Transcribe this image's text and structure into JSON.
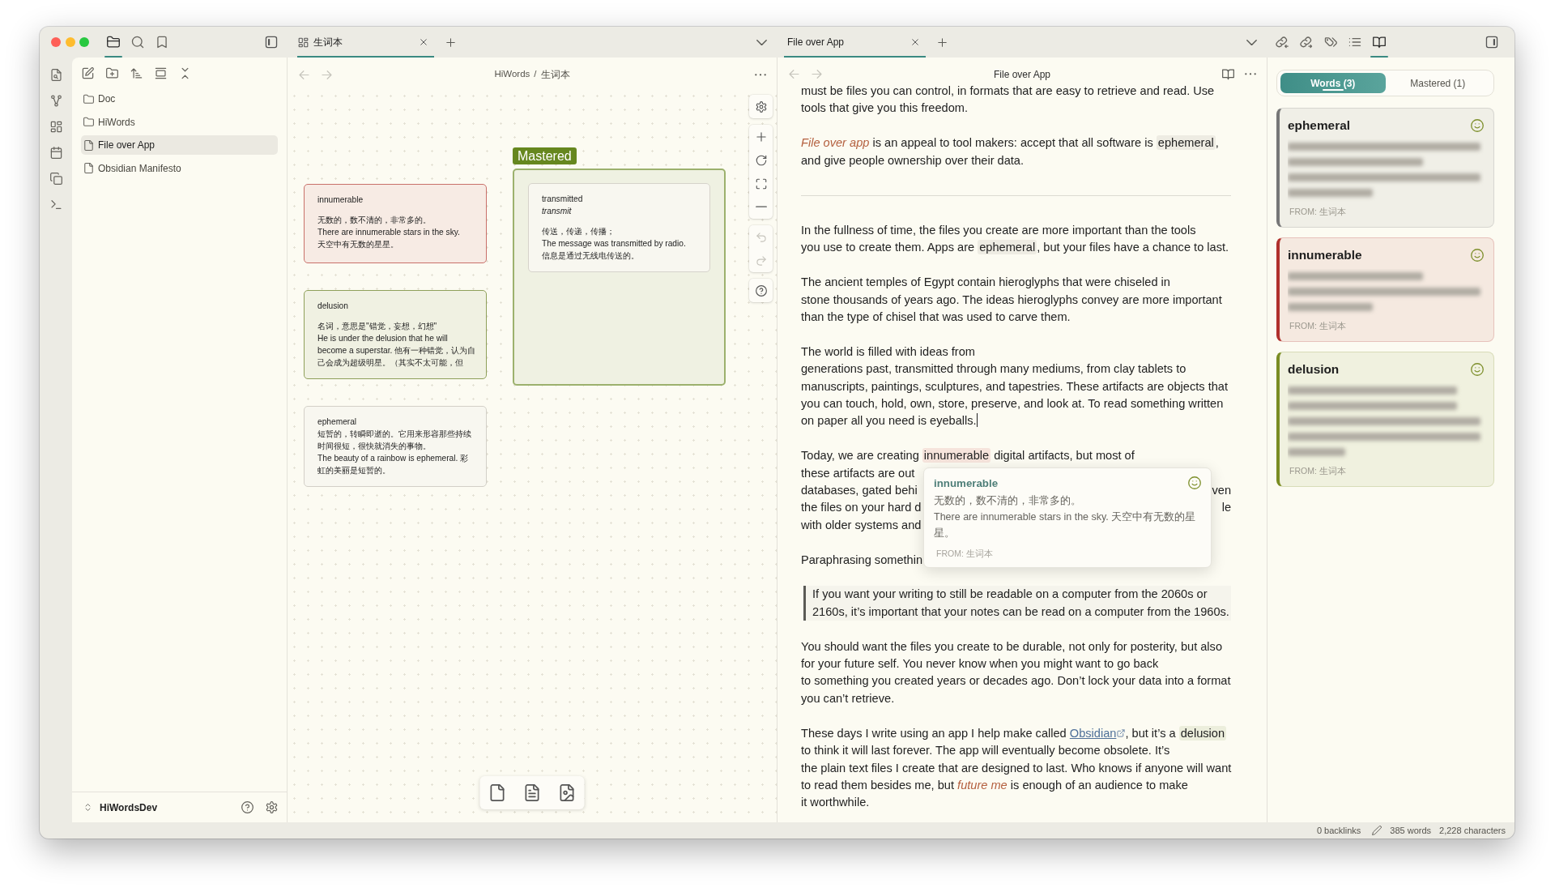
{
  "left_sidebar": {
    "tabs": [
      {
        "kind": "files",
        "selected": true
      },
      {
        "kind": "search",
        "selected": false
      },
      {
        "kind": "bookmarks",
        "selected": false
      }
    ],
    "files": [
      {
        "kind": "folder",
        "label": "Doc",
        "selected": false
      },
      {
        "kind": "folder",
        "label": "HiWords",
        "selected": false
      },
      {
        "kind": "file",
        "label": "File over App",
        "selected": true
      },
      {
        "kind": "file",
        "label": "Obsidian Manifesto",
        "selected": false
      }
    ],
    "vault": {
      "name": "HiWordsDev"
    }
  },
  "canvas_pane": {
    "tabs": [
      {
        "kind": "canvas",
        "label": "生词本",
        "selected": true
      }
    ],
    "nav": [
      {
        "kind": "back",
        "disabled": true
      },
      {
        "kind": "forward",
        "disabled": true
      }
    ],
    "breadcrumb": {
      "parts": [
        "HiWords",
        "生词本"
      ],
      "separator": "/"
    },
    "cards": [
      {
        "color": "#c9706a",
        "paragraphs": [
          [
            "innumerable"
          ],
          [
            "无数的，数不清的，非常多的。",
            "There are innumerable stars in the sky.",
            "天空中有无数的星星。"
          ]
        ]
      },
      {
        "color": "#8fa05a",
        "paragraphs": [
          [
            "delusion"
          ],
          [
            "名词，意思是\"错觉，妄想，幻想\"",
            "He is under the delusion that he will become a superstar. 他有一种错觉，认为自己会成为超级明星。（其实不太可能，但"
          ]
        ]
      },
      {
        "color": "#d3d0c8",
        "paragraphs": [
          [
            "ephemeral",
            "短暂的，转瞬即逝的。它用来形容那些持续时间很短，很快就消失的事物。",
            "The beauty of a rainbow is ephemeral. 彩虹的美丽是短暂的。"
          ]
        ]
      }
    ],
    "groups": [
      {
        "label": "Mastered",
        "color": "#66871f",
        "cards": [
          {
            "color": "#d6d3cb",
            "paragraphs": [
              [
                "transmitted",
                "*transmit*"
              ],
              [
                "传送，传递，传播；",
                "The message was transmitted by radio.",
                "信息是通过无线电传送的。"
              ]
            ]
          }
        ]
      }
    ],
    "controls": [
      {
        "items": [
          {
            "kind": "settings",
            "disabled": false
          }
        ]
      },
      {
        "items": [
          {
            "kind": "zoom-in",
            "disabled": false
          },
          {
            "kind": "reset",
            "disabled": false
          },
          {
            "kind": "fit",
            "disabled": false
          },
          {
            "kind": "zoom-out",
            "disabled": false
          }
        ]
      },
      {
        "items": [
          {
            "kind": "undo",
            "disabled": true
          },
          {
            "kind": "redo",
            "disabled": true
          }
        ]
      },
      {
        "items": [
          {
            "kind": "help",
            "disabled": false
          }
        ]
      }
    ]
  },
  "editor_pane": {
    "tabs": [
      {
        "label": "File over App",
        "selected": true
      }
    ],
    "nav": [
      {
        "kind": "back",
        "disabled": true
      },
      {
        "kind": "forward",
        "disabled": true
      }
    ],
    "title": "File over App",
    "blocks": [
      {
        "kind": "paragraph",
        "lines": [
          "must be files you can control, in formats that are easy to retrieve and read. Use",
          "tools that give you this freedom."
        ]
      },
      {
        "kind": "paragraph",
        "lines": [
          [
            {
              "kind": "emphasis",
              "text": "File over app"
            },
            {
              "kind": "plain",
              "text": " is an appeal to tool makers: accept that all software is "
            },
            {
              "kind": "highlight",
              "text": "ephemeral",
              "color": "#eeece3"
            },
            {
              "kind": "plain",
              "text": ","
            }
          ],
          "and give people ownership over their data."
        ]
      },
      {
        "kind": "rule"
      },
      {
        "kind": "paragraph",
        "lines": [
          "In the fullness of time, the files you create are more important than the tools",
          [
            {
              "kind": "plain",
              "text": "you use to create them. Apps are "
            },
            {
              "kind": "highlight",
              "text": "ephemeral",
              "color": "#eeece3"
            },
            {
              "kind": "plain",
              "text": ", but your files have a chance to last."
            }
          ]
        ]
      },
      {
        "kind": "paragraph",
        "lines": [
          "The ancient temples of Egypt contain hieroglyphs that were chiseled in",
          "stone thousands of years ago. The ideas hieroglyphs convey are more important",
          "than the type of chisel that was used to carve them."
        ]
      },
      {
        "kind": "paragraph",
        "lines": [
          "The world is filled with ideas from",
          "generations past, transmitted through many mediums, from clay tablets to",
          "manuscripts, paintings, sculptures, and tapestries. These artifacts are objects that",
          "you can touch, hold, own, store, preserve, and look at. To read something written",
          [
            {
              "kind": "plain",
              "text": "on paper all you need is eyeballs."
            },
            {
              "kind": "caret"
            }
          ]
        ]
      },
      {
        "kind": "covered",
        "lines": [
          {
            "left": [
              {
                "kind": "plain",
                "text": "Today, we are creating "
              },
              {
                "kind": "highlight",
                "text": "innumerable",
                "color": "#f6e4dc"
              },
              {
                "kind": "plain",
                "text": " digital artifacts, but most of"
              }
            ]
          },
          {
            "left": "these artifacts are out"
          },
          {
            "left": "databases, gated behi",
            "right": "ven"
          },
          {
            "left": "the files on your hard d",
            "right": "le"
          },
          {
            "left": "with older systems and"
          }
        ]
      },
      {
        "kind": "covered",
        "lines": [
          {
            "left": "Paraphrasing somethin"
          }
        ]
      },
      {
        "kind": "quote",
        "lines": [
          "If you want your writing to still be readable on a computer from the 2060s or",
          "2160s, it’s important that your notes can be read on a computer from the 1960s."
        ]
      },
      {
        "kind": "paragraph",
        "lines": [
          "You should want the files you create to be durable, not only for posterity, but also",
          "for your future self. You never know when you might want to go back",
          "to something you created years or decades ago. Don’t lock your data into a format",
          "you can’t retrieve."
        ]
      },
      {
        "kind": "paragraph",
        "lines": [
          [
            {
              "kind": "plain",
              "text": "These days I write using an app I help make called "
            },
            {
              "kind": "link",
              "text": "Obsidian"
            },
            {
              "kind": "plain",
              "text": ", but it’s a "
            },
            {
              "kind": "highlight",
              "text": "delusion",
              "color": "#eceedc"
            }
          ],
          "to think it will last forever. The app will eventually become obsolete. It’s",
          "the plain text files I create that are designed to last. Who knows if anyone will want",
          [
            {
              "kind": "plain",
              "text": "to read them besides me, but "
            },
            {
              "kind": "emphasis",
              "text": "future me"
            },
            {
              "kind": "plain",
              "text": " is enough of an audience to make"
            }
          ],
          "it worthwhile."
        ]
      }
    ],
    "popup": {
      "word": "innumerable",
      "lines": [
        "无数的，数不清的，非常多的。",
        "There are innumerable stars in the sky. 天空中有无数的星星。"
      ],
      "source": "FROM: 生词本"
    }
  },
  "right_sidebar": {
    "tabs": [
      {
        "kind": "backlinks",
        "selected": false
      },
      {
        "kind": "outgoing-links",
        "selected": false
      },
      {
        "kind": "tags",
        "selected": false
      },
      {
        "kind": "outline",
        "selected": false
      },
      {
        "kind": "words",
        "selected": true
      }
    ],
    "segments": [
      {
        "label": "Words (3)",
        "selected": true
      },
      {
        "label": "Mastered (1)",
        "selected": false
      }
    ],
    "cards": [
      {
        "word": "ephemeral",
        "color": "#777777",
        "blurred_lines": [
          {
            "kind": "full"
          },
          {
            "kind": "medium"
          },
          {
            "kind": "full"
          },
          {
            "kind": "short"
          }
        ],
        "source": "FROM: 生词本"
      },
      {
        "word": "innumerable",
        "color": "#b0302c",
        "blurred_lines": [
          {
            "kind": "medium"
          },
          {
            "kind": "full"
          },
          {
            "kind": "short"
          }
        ],
        "source": "FROM: 生词本"
      },
      {
        "word": "delusion",
        "color": "#7a8c22",
        "blurred_lines": [
          {
            "kind": "long"
          },
          {
            "kind": "long"
          },
          {
            "kind": "full"
          },
          {
            "kind": "full"
          },
          {
            "kind": "tiny"
          }
        ],
        "source": "FROM: 生词本"
      }
    ]
  },
  "status_bar": {
    "backlinks": "0 backlinks",
    "words": "385 words",
    "characters": "2,228 characters"
  }
}
